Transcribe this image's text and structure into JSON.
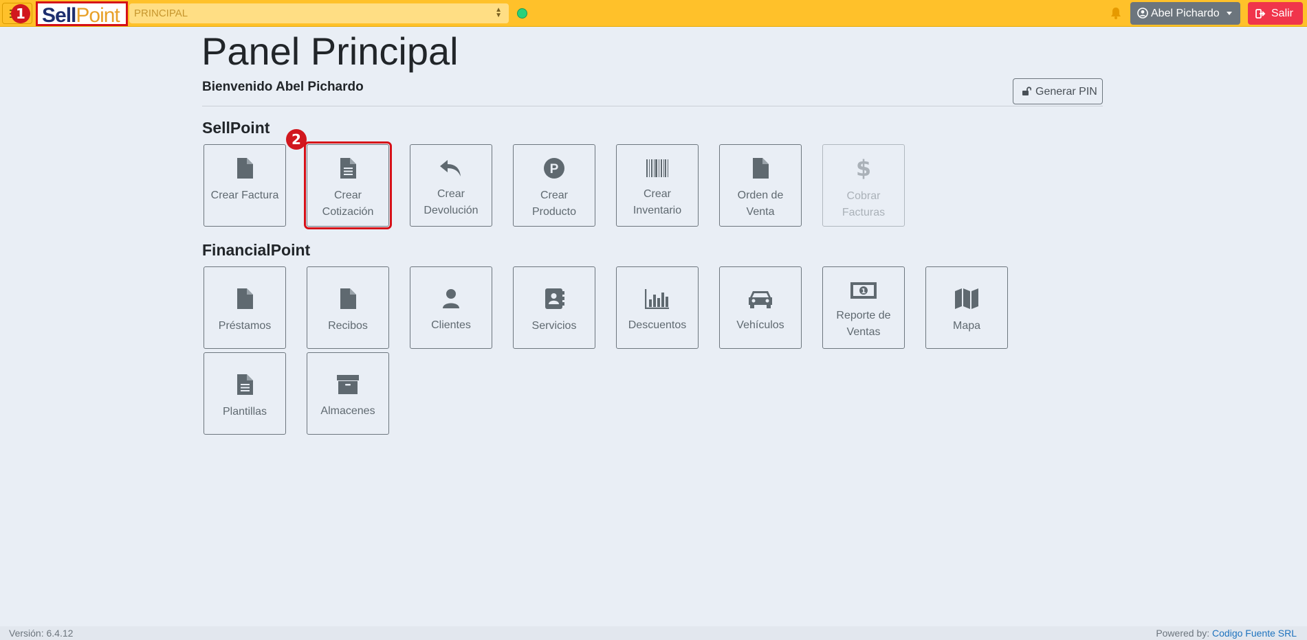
{
  "topbar": {
    "brand_sell": "Sell",
    "brand_point": "Point",
    "module_select": "PRINCIPAL",
    "user_name": "Abel Pichardo",
    "logout_label": "Salir"
  },
  "markers": {
    "one": "1",
    "two": "2"
  },
  "main": {
    "title": "Panel Principal",
    "welcome": "Bienvenido Abel Pichardo",
    "pin_button": "Generar PIN"
  },
  "sellpoint": {
    "title": "SellPoint",
    "tiles": [
      {
        "label": "Crear Factura",
        "icon": "file-icon"
      },
      {
        "label": "Crear Cotización",
        "icon": "file-lines-icon"
      },
      {
        "label": "Crear Devolución",
        "icon": "reply-icon"
      },
      {
        "label": "Crear Producto",
        "icon": "product-p-icon"
      },
      {
        "label": "Crear Inventario",
        "icon": "barcode-icon"
      },
      {
        "label": "Orden de Venta",
        "icon": "file-icon"
      },
      {
        "label": "Cobrar Facturas",
        "icon": "dollar-icon",
        "disabled": true
      }
    ]
  },
  "financialpoint": {
    "title": "FinancialPoint",
    "tiles": [
      {
        "label": "Préstamos",
        "icon": "file-icon"
      },
      {
        "label": "Recibos",
        "icon": "file-icon"
      },
      {
        "label": "Clientes",
        "icon": "user-icon"
      },
      {
        "label": "Servicios",
        "icon": "address-book-icon"
      },
      {
        "label": "Descuentos",
        "icon": "bar-chart-icon"
      },
      {
        "label": "Vehículos",
        "icon": "car-icon"
      },
      {
        "label": "Reporte de Ventas",
        "icon": "money-bill-icon"
      },
      {
        "label": "Mapa",
        "icon": "map-icon"
      },
      {
        "label": "Plantillas",
        "icon": "file-lines-icon"
      },
      {
        "label": "Almacenes",
        "icon": "archive-icon"
      }
    ]
  },
  "footer": {
    "version": "Versión: 6.4.12",
    "powered_prefix": "Powered by: ",
    "powered_link": "Codigo Fuente SRL"
  },
  "colors": {
    "topbar": "#ffc12a",
    "logout": "#f0354b",
    "user_button": "#6c757d",
    "annotation_red": "#d60f17",
    "status_dot": "#29d17a"
  }
}
